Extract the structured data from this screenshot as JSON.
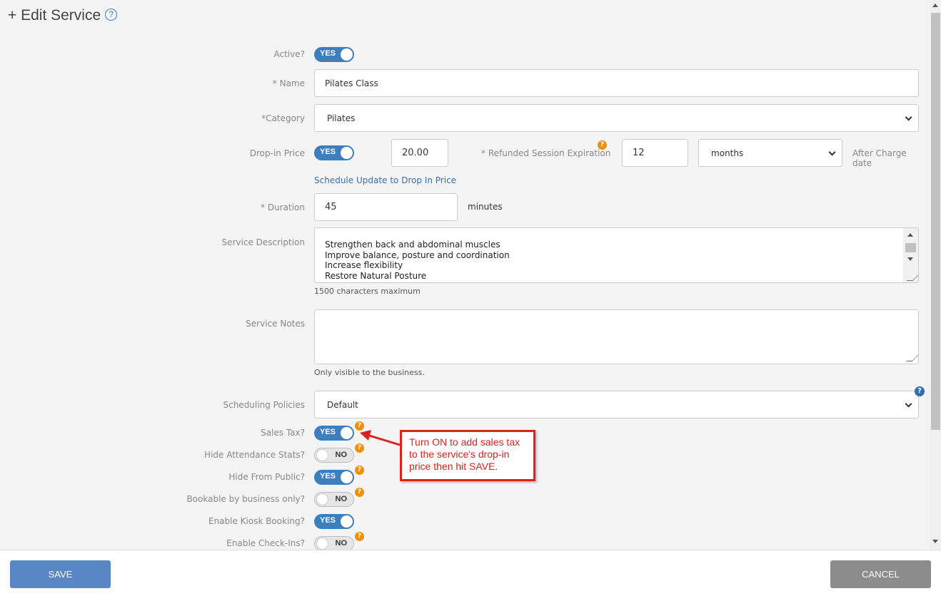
{
  "header": {
    "title": "+ Edit Service",
    "help_glyph": "?"
  },
  "form": {
    "active": {
      "label": "Active?",
      "value": "YES"
    },
    "name": {
      "label": "* Name",
      "value": "Pilates Class"
    },
    "category": {
      "label": "*Category",
      "value": "Pilates"
    },
    "dropin": {
      "label": "Drop-in Price",
      "toggle": "YES",
      "price": "20.00",
      "refund_label": "* Refunded Session Expiration",
      "refund_value": "12",
      "refund_unit": "months",
      "after_label": "After Charge date",
      "schedule_link": "Schedule Update to Drop In Price"
    },
    "duration": {
      "label": "* Duration",
      "value": "45",
      "unit": "minutes"
    },
    "description": {
      "label": "Service Description",
      "value": "Strengthen back and abdominal muscles\nImprove balance, posture and coordination\nIncrease flexibility\nRestore Natural Posture",
      "hint": "1500 characters maximum"
    },
    "notes": {
      "label": "Service Notes",
      "value": "",
      "hint": "Only visible to the business."
    },
    "scheduling": {
      "label": "Scheduling Policies",
      "value": "Default"
    },
    "toggles": [
      {
        "label": "Sales Tax?",
        "value": "YES"
      },
      {
        "label": "Hide Attendance Stats?",
        "value": "NO"
      },
      {
        "label": "Hide From Public?",
        "value": "YES"
      },
      {
        "label": "Bookable by business only?",
        "value": "NO"
      },
      {
        "label": "Enable Kiosk Booking?",
        "value": "YES"
      },
      {
        "label": "Enable Check-Ins?",
        "value": "NO"
      }
    ]
  },
  "callout": {
    "text": "Turn ON to add sales tax to the service's drop-in price then hit SAVE."
  },
  "footer": {
    "save": "SAVE",
    "cancel": "CANCEL"
  },
  "colors": {
    "accent": "#3d7ebf",
    "badge": "#f0900c",
    "callout": "#e0201c",
    "save_btn": "#5b86c5",
    "cancel_btn": "#8c8c8c"
  }
}
